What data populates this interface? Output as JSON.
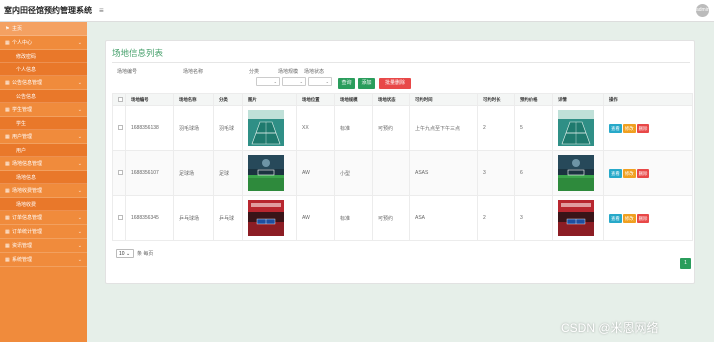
{
  "app": {
    "title": "室内田径馆预约管理系统",
    "menu_icon": "≡",
    "avatar_label": "admin"
  },
  "sidebar": {
    "items": [
      {
        "label": "主页",
        "type": "home",
        "icon": "flag-icon"
      },
      {
        "label": "个人中心",
        "type": "group"
      },
      {
        "label": "修改密码",
        "type": "sub"
      },
      {
        "label": "个人信息",
        "type": "sub"
      },
      {
        "label": "公告信息管理",
        "type": "group"
      },
      {
        "label": "公告信息",
        "type": "sub"
      },
      {
        "label": "学生管理",
        "type": "group"
      },
      {
        "label": "学生",
        "type": "sub"
      },
      {
        "label": "用户管理",
        "type": "group"
      },
      {
        "label": "用户",
        "type": "sub"
      },
      {
        "label": "场地信息管理",
        "type": "group"
      },
      {
        "label": "场地信息",
        "type": "sub"
      },
      {
        "label": "场地收费管理",
        "type": "group"
      },
      {
        "label": "场地收费",
        "type": "sub"
      },
      {
        "label": "订单信息管理",
        "type": "group"
      },
      {
        "label": "订单统计管理",
        "type": "group"
      },
      {
        "label": "资讯管理",
        "type": "group"
      },
      {
        "label": "系统管理",
        "type": "group"
      }
    ]
  },
  "page": {
    "title": "场地信息列表",
    "filters": {
      "venue_no": "场地编号",
      "venue_name": "场地名称",
      "category": "分类",
      "venue_size": "场地规模",
      "venue_status": "场地状态"
    },
    "buttons": {
      "search": "查询",
      "add": "添加",
      "batch_delete": "批量删除"
    },
    "table": {
      "headers": [
        "场地编号",
        "场地名称",
        "分类",
        "图片",
        "场地位置",
        "场地规模",
        "场地状态",
        "可约时间",
        "可约时长",
        "预约价格",
        "详情",
        "操作"
      ],
      "rows": [
        {
          "no": "1688356138",
          "name": "羽毛球场",
          "category": "羽毛球",
          "image": "badminton",
          "location": "XX",
          "size": "标准",
          "status": "可预约",
          "time": "上午九点至下午三点",
          "duration": "2",
          "price": "5",
          "detail": "badminton"
        },
        {
          "no": "1688356107",
          "name": "足球场",
          "category": "足球",
          "image": "football",
          "location": "AW",
          "size": "小型",
          "status": "",
          "time": "ASAS",
          "duration": "3",
          "price": "6",
          "detail": "football"
        },
        {
          "no": "1688356345",
          "name": "乒乓球场",
          "category": "乒乓球",
          "image": "pingpong",
          "location": "AW",
          "size": "标准",
          "status": "可预约",
          "time": "ASA",
          "duration": "2",
          "price": "3",
          "detail": "pingpong"
        }
      ],
      "actions": {
        "view": "查看",
        "edit": "修改",
        "delete": "删除"
      }
    },
    "pagination": {
      "page_size": "10",
      "page_size_suffix": "条 每页",
      "current_page": "1"
    }
  },
  "watermark": "CSDN @米恩网络",
  "colors": {
    "sidebar": "#f08b3c",
    "accent": "#2a9d5c",
    "view": "#27a9c9",
    "edit": "#f0a020",
    "delete": "#e84848"
  }
}
